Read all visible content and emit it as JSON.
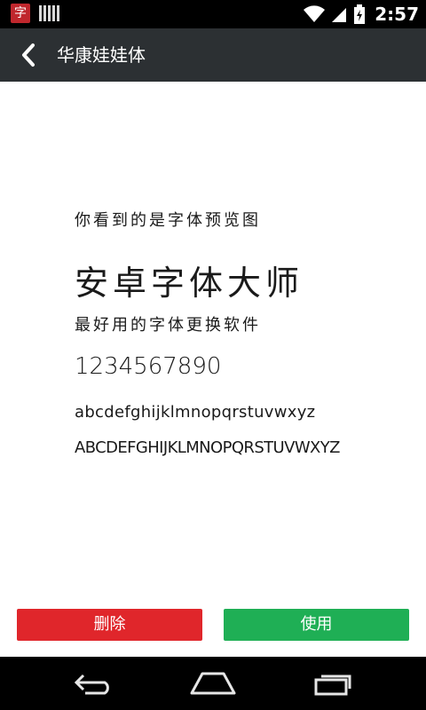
{
  "status_bar": {
    "app_badge": "字",
    "time": "2:57",
    "battery_level": 0.75
  },
  "action_bar": {
    "title": "华康娃娃体"
  },
  "preview": {
    "line1": "你看到的是字体预览图",
    "line2": "安卓字体大师",
    "line3": "最好用的字体更换软件",
    "line4": "1234567890",
    "line5": "abcdefghijklmnopqrstuvwxyz",
    "line6": "ABCDEFGHIJKLMNOPQRSTUVWXYZ"
  },
  "buttons": {
    "delete_label": "删除",
    "use_label": "使用",
    "delete_color": "#e0262b",
    "use_color": "#1faf55"
  },
  "nav_bar": {
    "icons": [
      "back-icon",
      "home-icon",
      "recents-icon"
    ]
  }
}
